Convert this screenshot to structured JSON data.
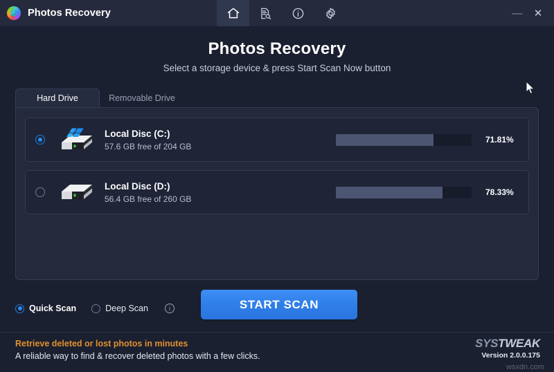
{
  "window": {
    "app_title": "Photos Recovery",
    "logo_icon": "photos-recovery-logo",
    "nav": [
      {
        "icon": "home-icon",
        "name": "home",
        "active": true
      },
      {
        "icon": "document-search-icon",
        "name": "scan-history",
        "active": false
      },
      {
        "icon": "info-circle-icon",
        "name": "info",
        "active": false
      },
      {
        "icon": "gear-icon",
        "name": "settings",
        "active": false
      }
    ],
    "minimize_label": "—",
    "close_label": "✕"
  },
  "header": {
    "title": "Photos Recovery",
    "subtitle": "Select a storage device & press Start Scan Now button"
  },
  "tabs": [
    {
      "label": "Hard Drive",
      "active": true
    },
    {
      "label": "Removable Drive",
      "active": false
    }
  ],
  "drives": [
    {
      "name": "Local Disc (C:)",
      "capacity_text": "57.6 GB free of 204 GB",
      "usage_percent_text": "71.81%",
      "usage_percent": 71.81,
      "selected": true,
      "has_windows_logo": true
    },
    {
      "name": "Local Disc (D:)",
      "capacity_text": "56.4 GB free of 260 GB",
      "usage_percent_text": "78.33%",
      "usage_percent": 78.33,
      "selected": false,
      "has_windows_logo": false
    }
  ],
  "scan_options": [
    {
      "label": "Quick Scan",
      "selected": true
    },
    {
      "label": "Deep Scan",
      "selected": false
    }
  ],
  "scan_info_icon": "info-icon",
  "start_button": {
    "label": "START SCAN"
  },
  "footer": {
    "tagline": "Retrieve deleted or lost photos in minutes",
    "description": "A reliable way to find & recover deleted photos with a few clicks.",
    "brand_sys": "SYS",
    "brand_tweak": "TWEAK",
    "version": "Version 2.0.0.175",
    "watermark": "wsxdn.com"
  },
  "colors": {
    "accent_blue": "#2f7fe8",
    "background": "#1b2030",
    "panel": "#242a3c",
    "titlebar": "#252b3d",
    "tagline_orange": "#e0902f",
    "bar_fill": "#4c5572"
  }
}
